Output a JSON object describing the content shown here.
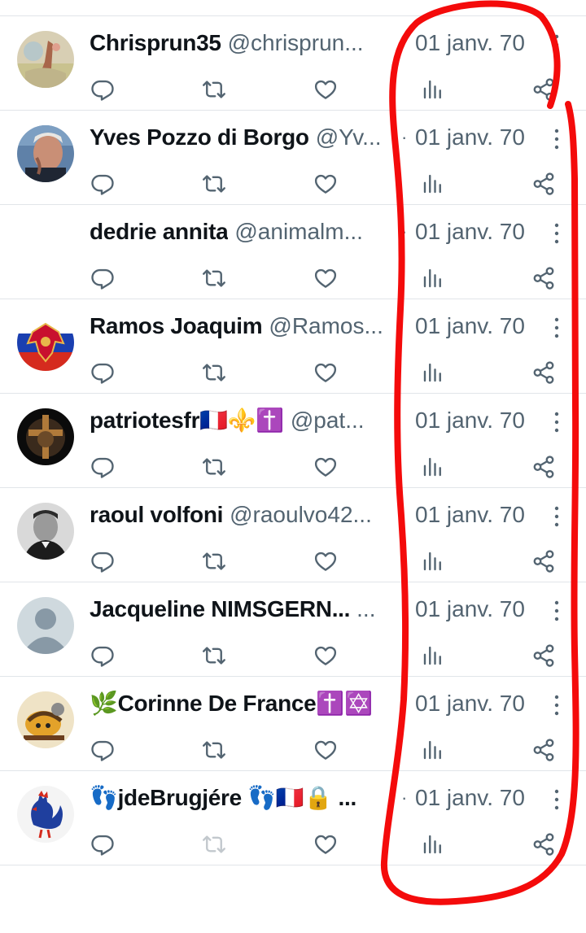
{
  "posts": [
    {
      "name": "Chrisprun35",
      "handle": "@chrisprun...",
      "sep": "",
      "date": "01 janv. 70",
      "avatar": "painting-avatar"
    },
    {
      "name": "Yves Pozzo di Borgo",
      "handle": "@Yv...",
      "sep": "·",
      "date": "01 janv. 70",
      "avatar": "man-photo-avatar"
    },
    {
      "name": "dedrie annita",
      "handle": "@animalm...",
      "sep": "·",
      "date": "01 janv. 70",
      "avatar": "empty-avatar"
    },
    {
      "name": "Ramos Joaquim",
      "handle": "@Ramos...",
      "sep": "",
      "date": "01 janv. 70",
      "avatar": "russian-coat-of-arms-avatar"
    },
    {
      "name": "patriotesfr🇫🇷⚜️✝️",
      "handle": "@pat...",
      "sep": "",
      "date": "01 janv. 70",
      "avatar": "cross-lion-avatar"
    },
    {
      "name": "raoul volfoni",
      "handle": "@raoulvo42...",
      "sep": "",
      "date": "01 janv. 70",
      "avatar": "bw-portrait-avatar"
    },
    {
      "name": "Jacqueline NIMSGERN...",
      "handle": "...",
      "sep": "",
      "date": "01 janv. 70",
      "avatar": "default-avatar"
    },
    {
      "name": "🌿Corinne De France✝️✡️",
      "handle": "",
      "sep": "",
      "date": "01 janv. 70",
      "avatar": "illustration-avatar"
    },
    {
      "name": "👣jdeBrugjére 👣🇫🇷🔒 ...",
      "handle": "",
      "sep": "·",
      "date": "01 janv. 70",
      "avatar": "rooster-avatar",
      "repost_disabled": true
    }
  ],
  "icons": {
    "reply": "reply-icon",
    "repost": "repost-icon",
    "like": "like-icon",
    "views": "views-icon",
    "share": "share-icon",
    "more": "more-icon"
  },
  "colors": {
    "text": "#0f1419",
    "muted": "#536471",
    "annotation": "#ff0000"
  }
}
